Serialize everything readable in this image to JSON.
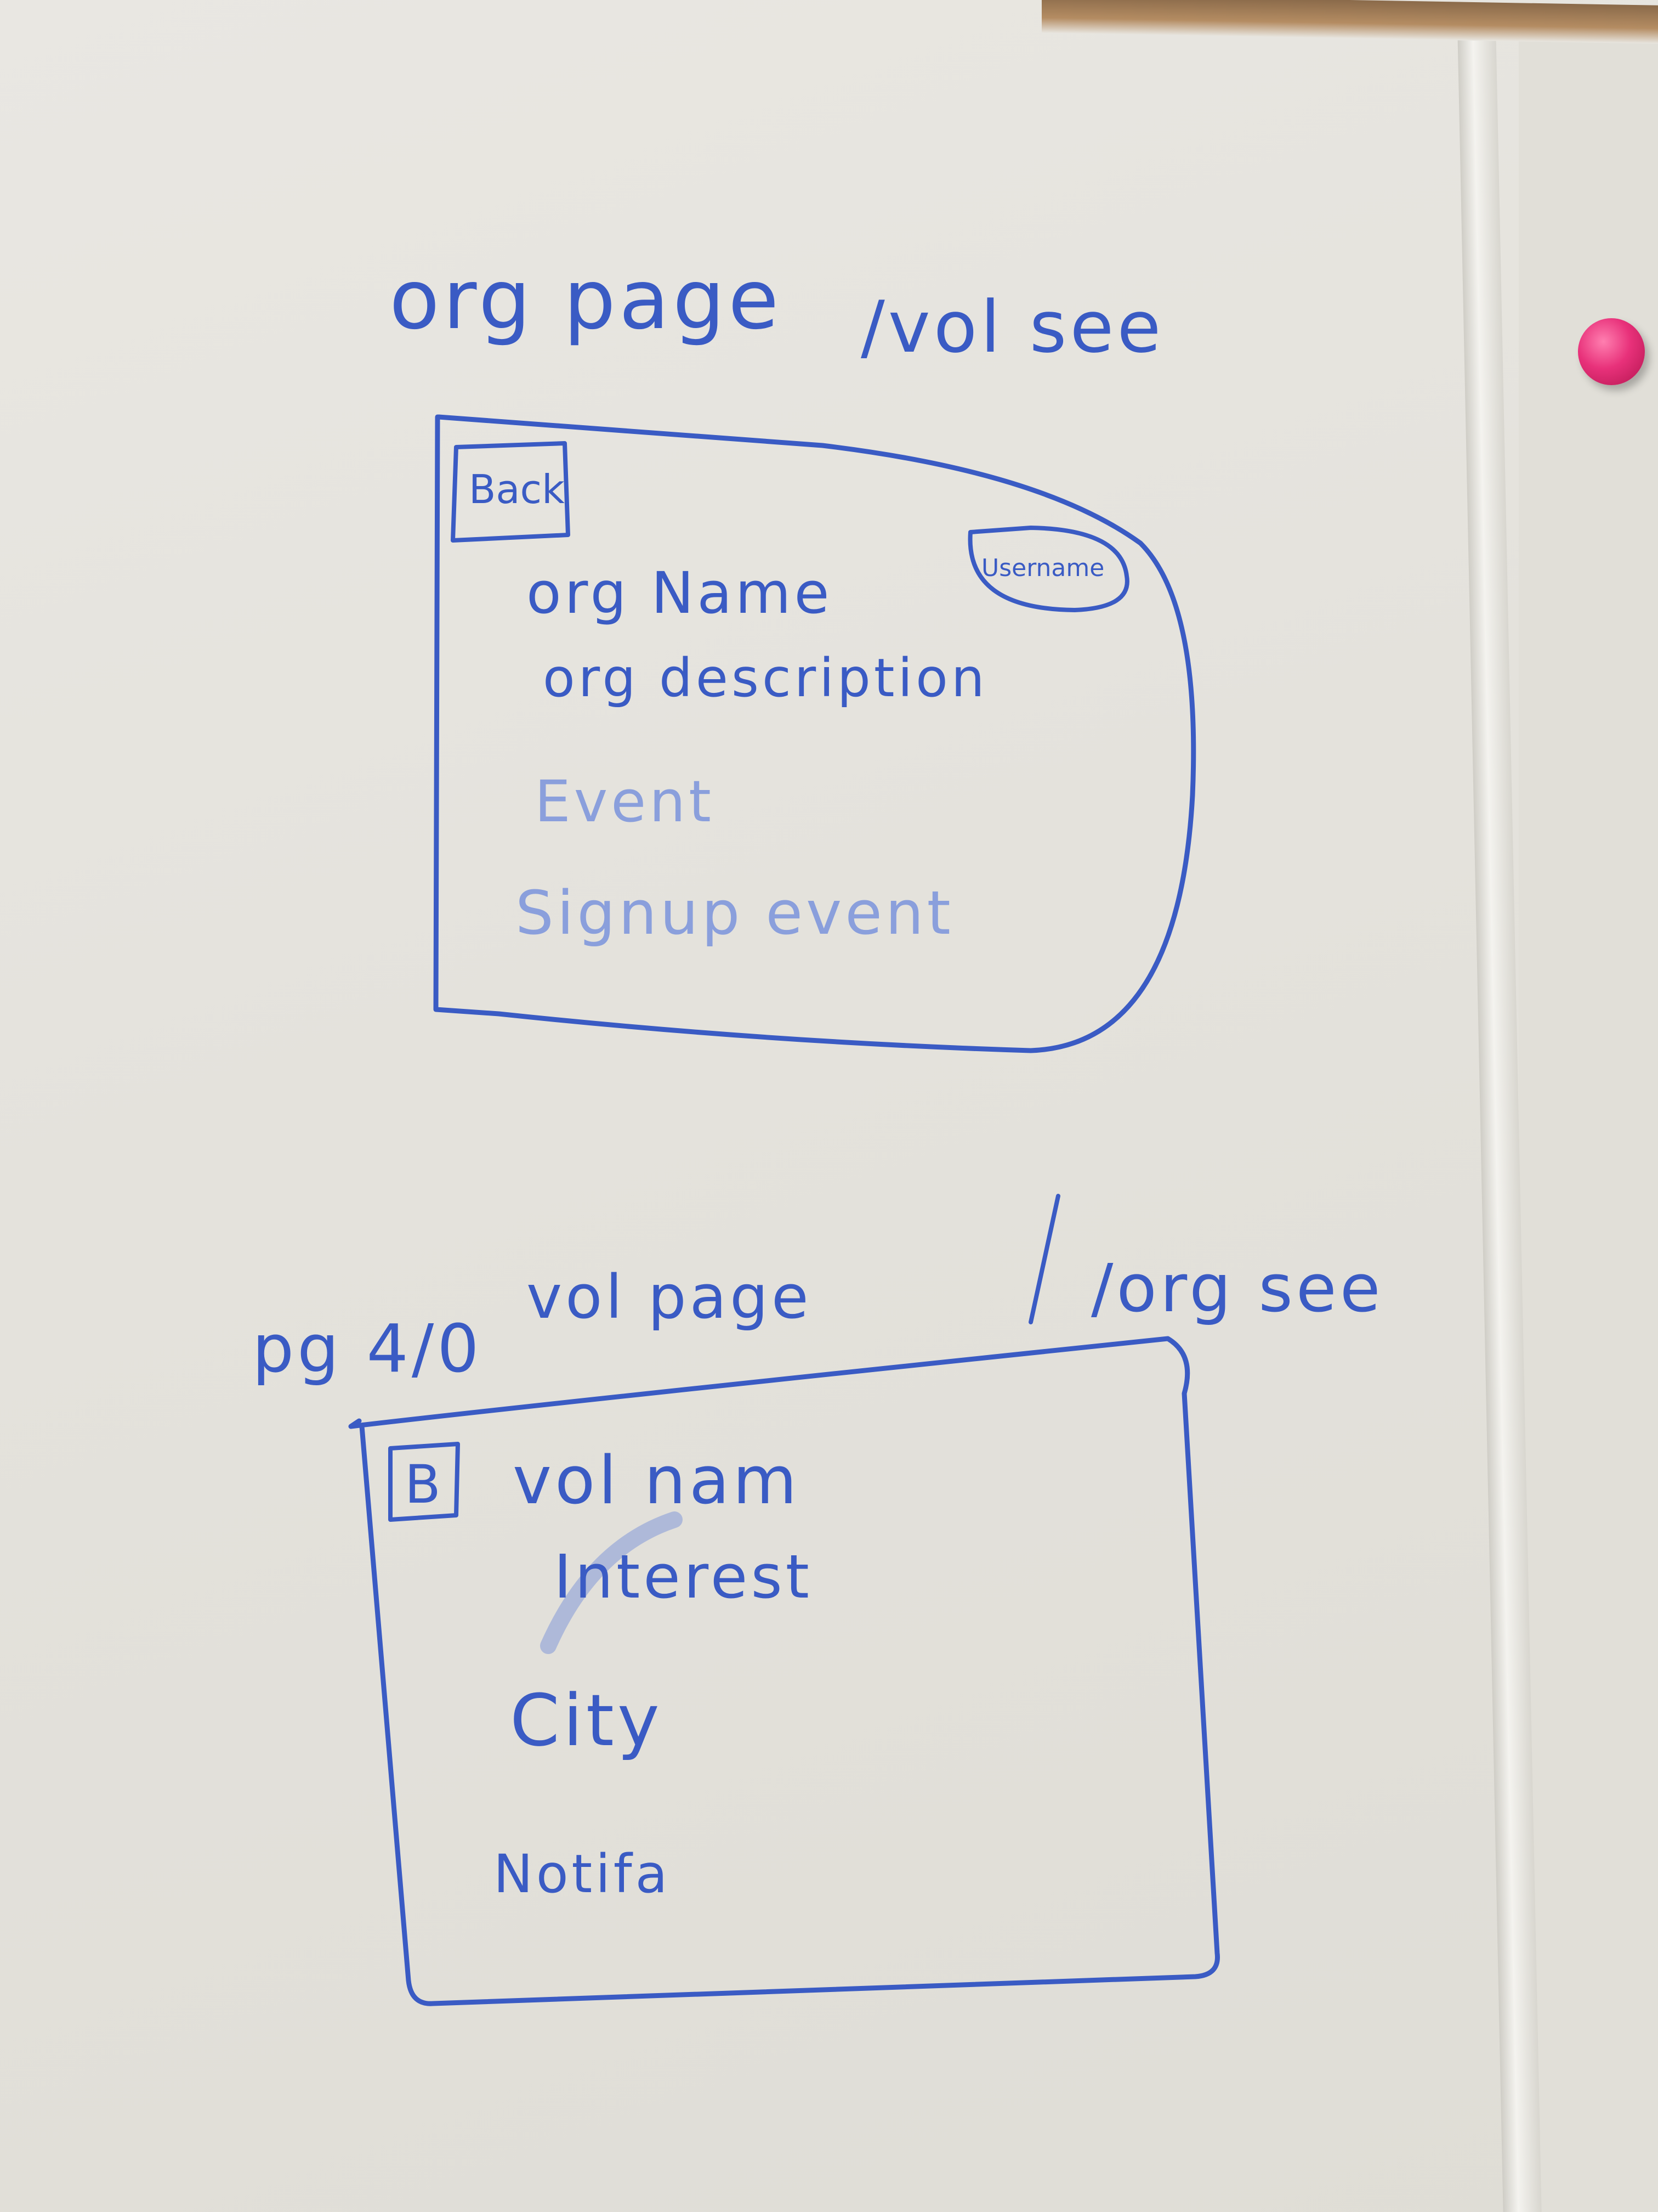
{
  "sketch1": {
    "title": "org page",
    "subtitle": "/vol see",
    "back_label": "Back",
    "username_label": "Username",
    "org_name": "org Name",
    "org_description": "org description",
    "event": "Event",
    "signup": "Signup event"
  },
  "sketch2": {
    "page_label": "pg 4/0",
    "title": "vol page",
    "subtitle": "/org see",
    "back_label": "B",
    "vol_name": "vol nam",
    "interest": "Interest",
    "city": "City",
    "notify": "Notifa"
  },
  "colors": {
    "ink": "#3a5bc4",
    "faded_ink": "#8a9fdc",
    "board": "#e6e4de",
    "magnet": "#e8317a"
  }
}
